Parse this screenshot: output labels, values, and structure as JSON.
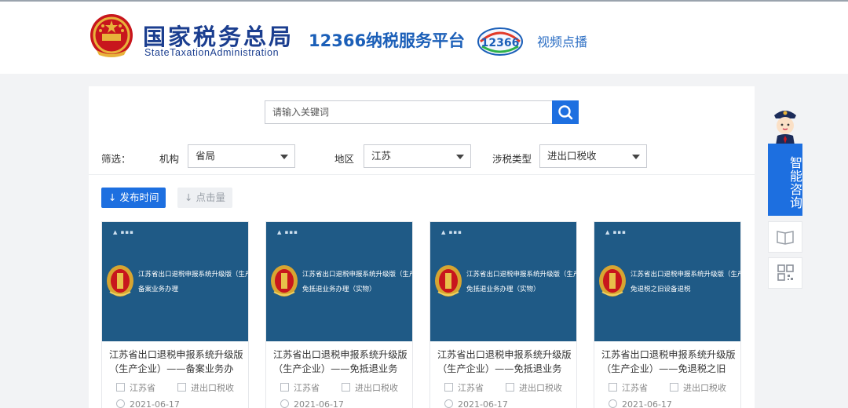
{
  "header": {
    "brand_cn": "国家税务总局",
    "brand_en": "StateTaxationAdministration",
    "platform": "12366纳税服务平台",
    "logo_number": "12366",
    "video_link": "视频点播"
  },
  "search": {
    "placeholder": "请输入关键词"
  },
  "filters": {
    "label": "筛选：",
    "org_label": "机构",
    "org_value": "省局",
    "region_label": "地区",
    "region_value": "江苏",
    "tax_label": "涉税类型",
    "tax_value": "进出口税收"
  },
  "sort": {
    "publish_time": "↓ 发布时间",
    "views": "↓ 点击量"
  },
  "cards": [
    {
      "thumb_line1": "江苏省出口退税申报系统升级版（生产企业）",
      "thumb_line2": "备案业务办理",
      "title": "江苏省出口退税申报系统升级版（生产企业）——备案业务办",
      "province": "江苏省",
      "type": "进出口税收",
      "date": "2021-06-17"
    },
    {
      "thumb_line1": "江苏省出口退税申报系统升级版（生产企业）",
      "thumb_line2": "免抵退业务办理（实物）",
      "title": "江苏省出口退税申报系统升级版（生产企业）——免抵退业务",
      "province": "江苏省",
      "type": "进出口税收",
      "date": "2021-06-17"
    },
    {
      "thumb_line1": "江苏省出口退税申报系统升级版（生产企业）",
      "thumb_line2": "免抵退业务办理（实物）",
      "title": "江苏省出口退税申报系统升级版（生产企业）——免抵退业务",
      "province": "江苏省",
      "type": "进出口税收",
      "date": "2021-06-17"
    },
    {
      "thumb_line1": "江苏省出口退税申报系统升级版（生产企业）",
      "thumb_line2": "免退税之旧设备退税",
      "title": "江苏省出口退税申报系统升级版（生产企业）——免退税之旧",
      "province": "江苏省",
      "type": "进出口税收",
      "date": "2021-06-17"
    }
  ],
  "sidebar": {
    "consult": "智能咨询"
  },
  "colors": {
    "brand_blue": "#1b3e8f",
    "accent": "#1d6fe0",
    "thumb_bg": "#1f5a86"
  }
}
